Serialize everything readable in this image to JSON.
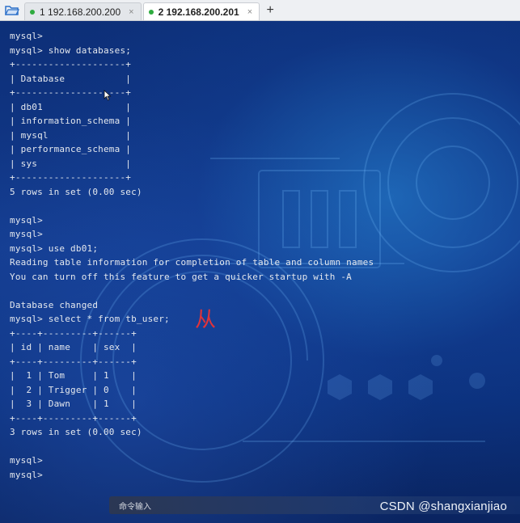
{
  "tabs": [
    {
      "index": "1",
      "host": "192.168.200.200",
      "active": false
    },
    {
      "index": "2",
      "host": "192.168.200.201",
      "active": true
    }
  ],
  "tab_close_glyph": "×",
  "new_tab_glyph": "+",
  "terminal": {
    "lines": [
      "mysql>",
      "mysql> show databases;",
      "+--------------------+",
      "| Database           |",
      "+--------------------+",
      "| db01               |",
      "| information_schema |",
      "| mysql              |",
      "| performance_schema |",
      "| sys                |",
      "+--------------------+",
      "5 rows in set (0.00 sec)",
      "",
      "mysql>",
      "mysql>",
      "mysql> use db01;",
      "Reading table information for completion of table and column names",
      "You can turn off this feature to get a quicker startup with -A",
      "",
      "Database changed",
      "mysql> select * from tb_user;",
      "+----+---------+------+",
      "| id | name    | sex  |",
      "+----+---------+------+",
      "|  1 | Tom     | 1    |",
      "|  2 | Trigger | 0    |",
      "|  3 | Dawn    | 1    |",
      "+----+---------+------+",
      "3 rows in set (0.00 sec)",
      "",
      "mysql>",
      "mysql>"
    ]
  },
  "annotation_text": "从",
  "command_bar": {
    "placeholder": "命令输入"
  },
  "watermark": "CSDN @shangxianjiao",
  "colors": {
    "terminal_text": "#e4e8ee",
    "annotation": "#e0333a",
    "status_dot": "#2eab3f"
  }
}
